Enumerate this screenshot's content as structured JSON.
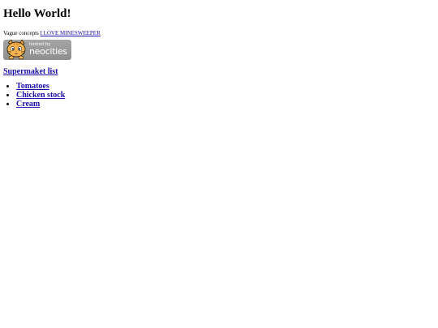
{
  "heading": "Hello World!",
  "concepts": {
    "prefix": "Vague concepts",
    "link_text": "I LOVE MINESWEEPER"
  },
  "badge": {
    "hosted_text": "hosted by",
    "brand_text": "neocities",
    "icon": "neocities-cat-icon"
  },
  "list_heading": "Supermaket list",
  "items": [
    {
      "label": "Tomatoes"
    },
    {
      "label": "Chicken stock"
    },
    {
      "label": "Cream"
    }
  ],
  "colors": {
    "link": "#1a0dab",
    "badge_bg": "#9a9a9a",
    "text": "#000000"
  }
}
